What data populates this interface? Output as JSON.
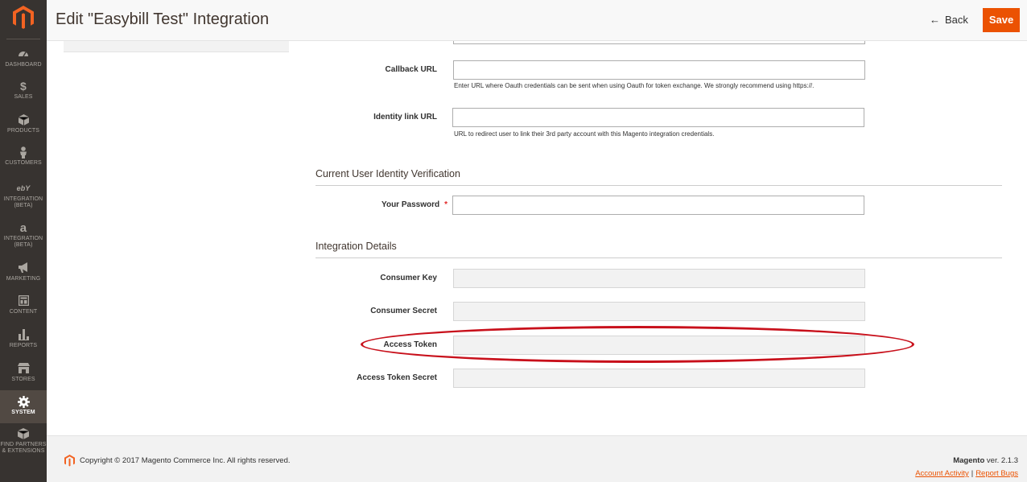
{
  "header": {
    "title": "Edit \"Easybill Test\" Integration",
    "back_label": "Back",
    "save_label": "Save"
  },
  "sidebar": {
    "items": [
      {
        "label": "DASHBOARD",
        "icon": "dashboard-icon"
      },
      {
        "label": "SALES",
        "icon": "dollar-icon"
      },
      {
        "label": "PRODUCTS",
        "icon": "cube-icon"
      },
      {
        "label": "CUSTOMERS",
        "icon": "person-icon"
      },
      {
        "label": "INTEGRATION (BETA)",
        "icon": "ebay-icon"
      },
      {
        "label": "INTEGRATION (BETA)",
        "icon": "amazon-icon"
      },
      {
        "label": "MARKETING",
        "icon": "megaphone-icon"
      },
      {
        "label": "CONTENT",
        "icon": "layout-icon"
      },
      {
        "label": "REPORTS",
        "icon": "bar-chart-icon"
      },
      {
        "label": "STORES",
        "icon": "store-icon"
      },
      {
        "label": "SYSTEM",
        "icon": "gear-icon",
        "active": true
      },
      {
        "label": "FIND PARTNERS & EXTENSIONS",
        "icon": "box-icon"
      }
    ]
  },
  "form": {
    "callback_url": {
      "label": "Callback URL",
      "value": "",
      "note": "Enter URL where Oauth credentials can be sent when using Oauth for token exchange. We strongly recommend using https://."
    },
    "identity_link_url": {
      "label": "Identity link URL",
      "value": "",
      "note": "URL to redirect user to link their 3rd party account with this Magento integration credentials."
    },
    "section_verification": "Current User Identity Verification",
    "password": {
      "label": "Your Password",
      "required_mark": "*",
      "value": ""
    },
    "section_details": "Integration Details",
    "consumer_key": {
      "label": "Consumer Key",
      "value": ""
    },
    "consumer_secret": {
      "label": "Consumer Secret",
      "value": ""
    },
    "access_token": {
      "label": "Access Token",
      "value": ""
    },
    "access_token_secret": {
      "label": "Access Token Secret",
      "value": ""
    }
  },
  "footer": {
    "copyright": "Copyright © 2017 Magento Commerce Inc. All rights reserved.",
    "brand": "Magento",
    "version": " ver. 2.1.3",
    "account_activity": "Account Activity",
    "separator": "|",
    "report_bugs": "Report Bugs"
  },
  "colors": {
    "accent": "#eb5202",
    "sidebar_bg": "#373330",
    "highlight": "#c8101b"
  }
}
